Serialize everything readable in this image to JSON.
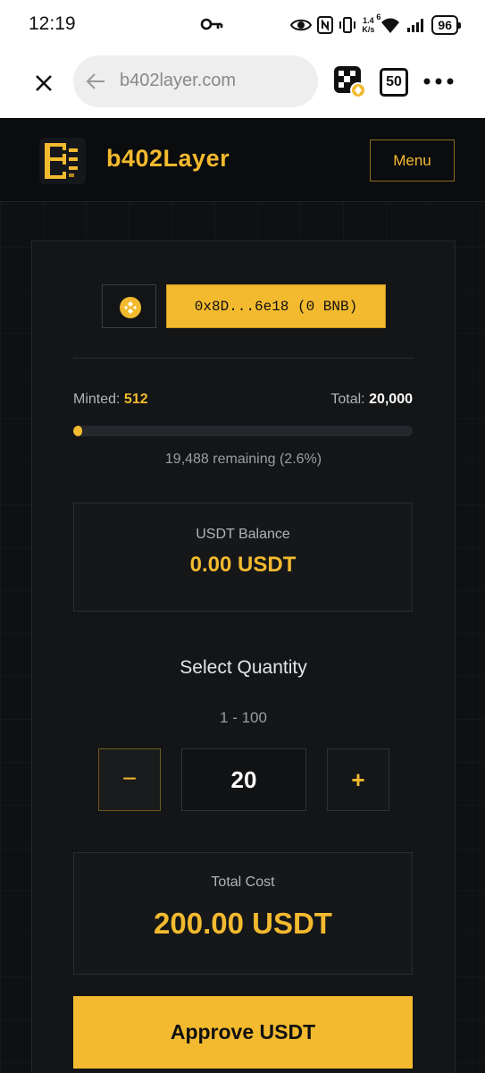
{
  "status_bar": {
    "time": "12:19",
    "net_speed_value": "1.4",
    "net_speed_unit": "K/s",
    "wifi_label": "6",
    "battery": "96"
  },
  "browser": {
    "url": "b402layer.com",
    "tab_count": "50"
  },
  "site": {
    "brand": "b402Layer",
    "menu_label": "Menu"
  },
  "wallet": {
    "address_label": "0x8D...6e18 (0 BNB)"
  },
  "mint": {
    "minted_label": "Minted:",
    "minted_value": "512",
    "total_label": "Total:",
    "total_value": "20,000",
    "progress_fraction": 0.026,
    "remaining_text": "19,488 remaining (2.6%)"
  },
  "balance": {
    "label": "USDT Balance",
    "value": "0.00 USDT"
  },
  "quantity": {
    "title": "Select Quantity",
    "range": "1 - 100",
    "minus_label": "−",
    "value": "20",
    "plus_label": "+"
  },
  "cost": {
    "label": "Total Cost",
    "value": "200.00 USDT"
  },
  "actions": {
    "approve_label": "Approve USDT"
  },
  "colors": {
    "accent": "#f3ba2f",
    "page_bg": "#0e1012",
    "card_bg": "#131517"
  }
}
